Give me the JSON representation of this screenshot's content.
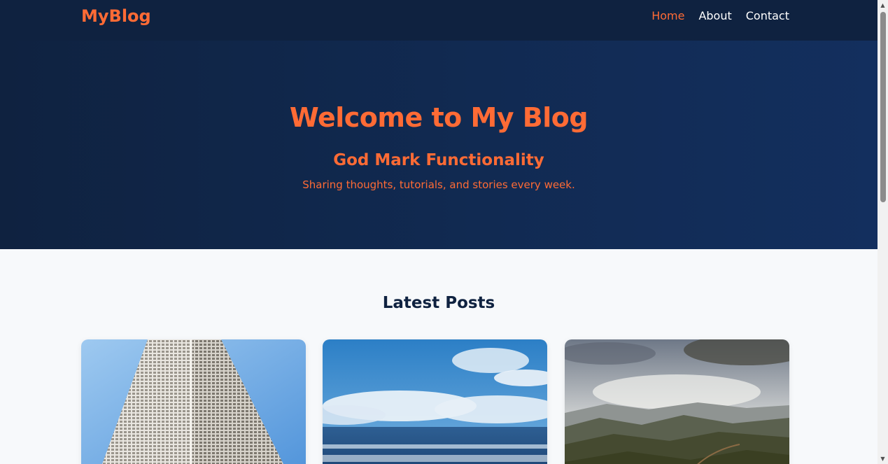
{
  "header": {
    "brand": "MyBlog",
    "nav": [
      {
        "label": "Home",
        "active": true
      },
      {
        "label": "About",
        "active": false
      },
      {
        "label": "Contact",
        "active": false
      }
    ]
  },
  "hero": {
    "title": "Welcome to My Blog",
    "subtitle": "God Mark Functionality",
    "tagline": "Sharing thoughts, tutorials, and stories every week."
  },
  "posts": {
    "heading": "Latest Posts",
    "cards": [
      {
        "image": "skyscraper-photo"
      },
      {
        "image": "ocean-beach-photo"
      },
      {
        "image": "mountain-valley-photo"
      }
    ]
  },
  "colors": {
    "accent": "#ff6b35",
    "navy": "#0f2240",
    "background": "#f7f9fb"
  },
  "icons": {
    "scroll_up": "arrow-up-icon",
    "scroll_down": "arrow-down-icon"
  }
}
